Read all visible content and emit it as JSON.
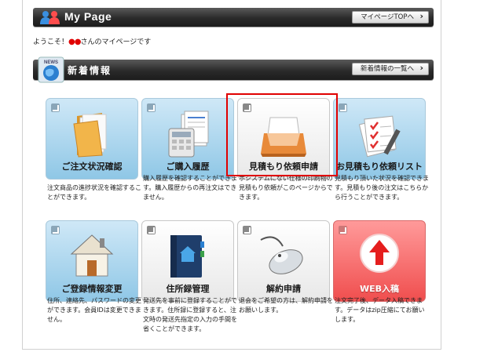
{
  "header": {
    "title": "My Page",
    "top_button": "マイページTOPへ"
  },
  "welcome": {
    "prefix": "ようこそ！",
    "name": "●●",
    "suffix": "さんのマイページです"
  },
  "news": {
    "icon_text": "NEWS",
    "title": "新着情報",
    "list_button": "新着情報の一覧へ"
  },
  "menu": [
    {
      "label": "ご注文状況確認",
      "icon": "folder-icon",
      "style": "blue",
      "desc": "注文商品の進捗状況を確認することができます。"
    },
    {
      "label": "ご購入履歴",
      "icon": "calculator-documents-icon",
      "style": "blue",
      "desc": "購入履歴を確認することができます。購入履歴からの再注文はできません。"
    },
    {
      "label": "見積もり依頼申請",
      "icon": "inbox-tray-icon",
      "style": "gray",
      "desc": "ホシステムにない仕様の印刷物の見積もり依頼がこのページからできます。"
    },
    {
      "label": "お見積もり依頼リスト",
      "icon": "checklist-icon",
      "style": "blue",
      "desc": "見積もり頂いた状況を確認できます。見積もり後の注文はこちらから行うことができます。"
    },
    {
      "label": "ご登録情報変更",
      "icon": "house-icon",
      "style": "blue",
      "desc": "住所、連絡先、パスワードの変更ができます。会員IDは変更できません。"
    },
    {
      "label": "住所録管理",
      "icon": "address-book-icon",
      "style": "gray",
      "desc": "発送先を事前に登録することができます。住所録に登録すると、注文時の発送先指定の入力の手間を省くことができます。"
    },
    {
      "label": "解約申請",
      "icon": "mouse-icon",
      "style": "gray",
      "desc": "退会をご希望の方は、解約申請をお願いします。"
    },
    {
      "label": "WEB入稿",
      "icon": "upload-arrow-icon",
      "style": "red",
      "desc": "注文完了後、データ入稿できます。データはzip圧縮にてお願いします。"
    }
  ],
  "colors": {
    "highlight": "#e00000",
    "bar": "#2a2a2a",
    "tile_blue": "#8fc7e6",
    "tile_red": "#f04e4e"
  }
}
